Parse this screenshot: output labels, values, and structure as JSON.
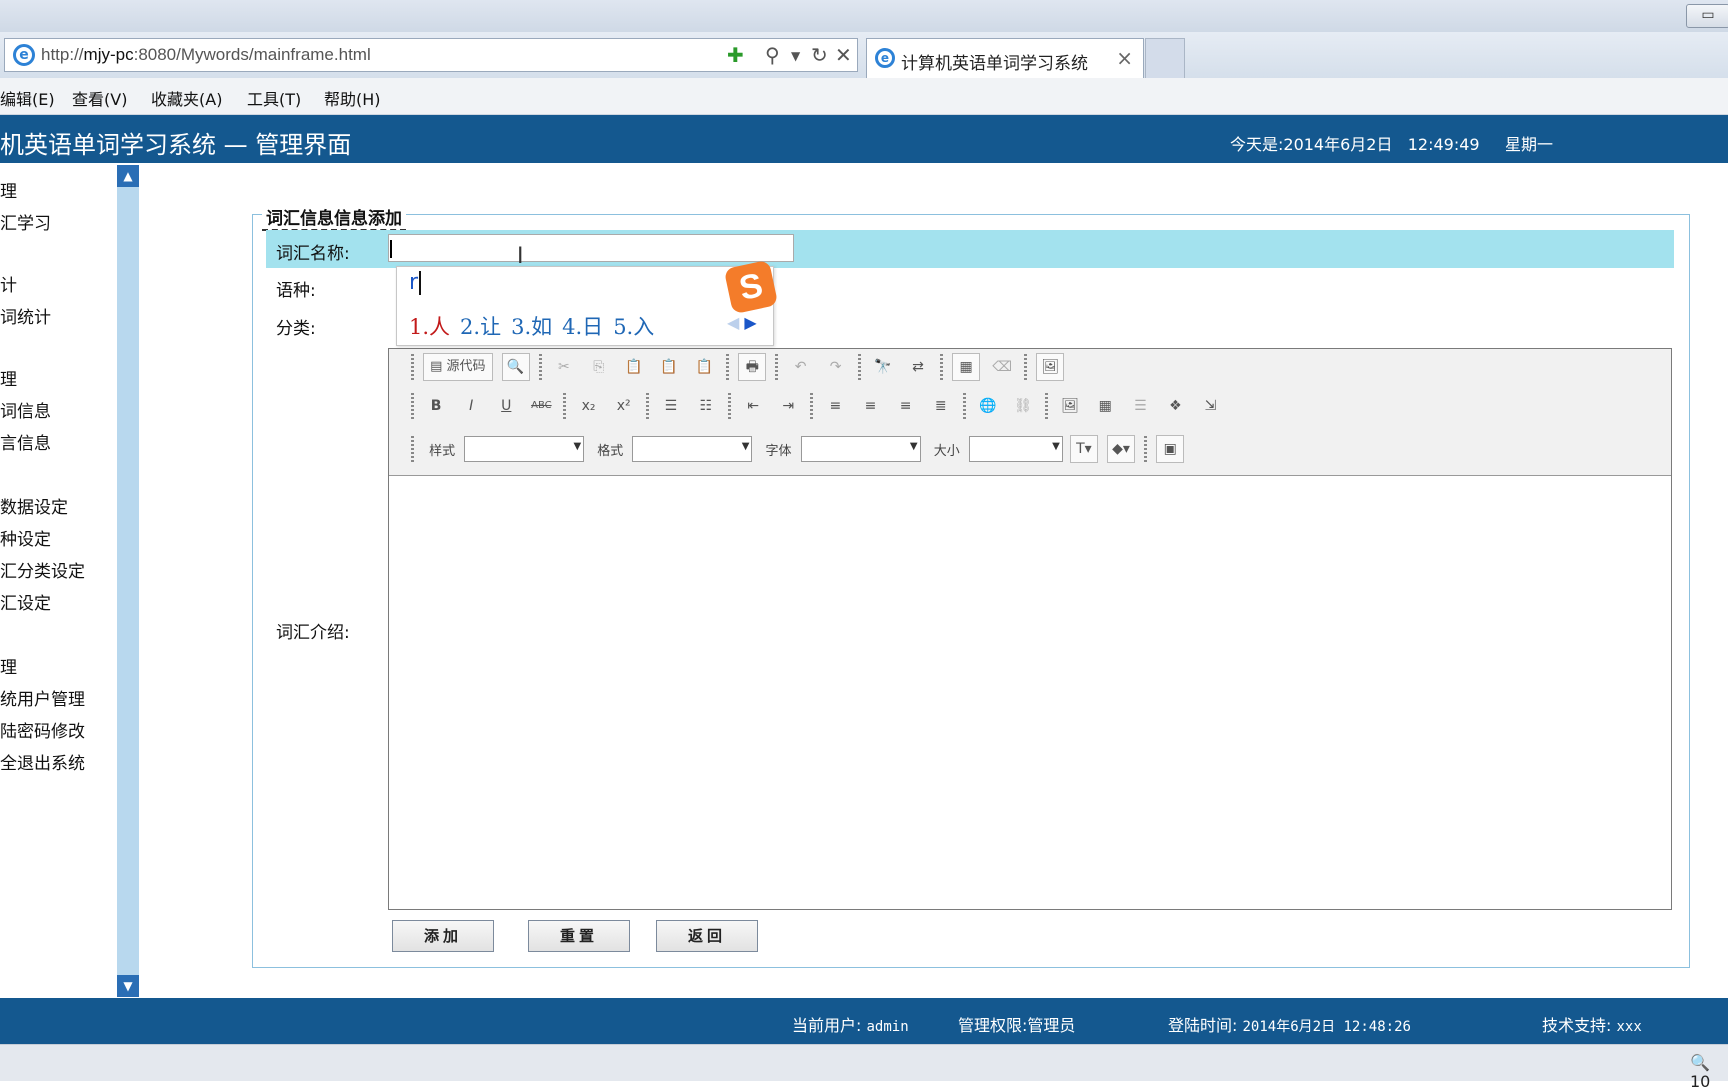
{
  "browser": {
    "url_prefix": "http://",
    "url_host": "mjy-pc",
    "url_rest": ":8080/Mywords/mainframe.html",
    "tab_title": "计算机英语单词学习系统",
    "tab_close": "×",
    "window_button": "▭",
    "menu": [
      "编辑(E)",
      "查看(V)",
      "收藏夹(A)",
      "工具(T)",
      "帮助(H)"
    ],
    "zoom": "10"
  },
  "header": {
    "title": "机英语单词学习系统 — 管理界面",
    "date_label": "今天是:2014年6月2日",
    "time": "12:49:49",
    "weekday": "星期一"
  },
  "sidebar": {
    "items": [
      "理",
      "汇学习",
      "计",
      "词统计",
      "理",
      "词信息",
      "言信息",
      "数据设定",
      "种设定",
      "汇分类设定",
      "汇设定",
      "理",
      "统用户管理",
      "陆密码修改",
      "全退出系统"
    ]
  },
  "form": {
    "legend": "词汇信息信息添加",
    "name_label": "词汇名称:",
    "name_value": "",
    "lang_label": "语种:",
    "category_label": "分类:",
    "intro_label": "词汇介绍:",
    "ime": {
      "composition": "r",
      "candidates": [
        "1.人",
        "2.让",
        "3.如",
        "4.日",
        "5.入"
      ],
      "logo": "S"
    },
    "editor": {
      "source_label": "源代码",
      "style_label": "样式",
      "format_label": "格式",
      "font_label": "字体",
      "size_label": "大小"
    },
    "buttons": {
      "add": "添加",
      "reset": "重置",
      "back": "返回"
    }
  },
  "footer": {
    "user_label": "当前用户:",
    "user": "admin",
    "role": "管理权限:管理员",
    "login_label": "登陆时间:",
    "login_time": "2014年6月2日 12:48:26",
    "support_label": "技术支持:",
    "support": "xxx"
  },
  "colors": {
    "header_bg": "#14588f",
    "row_highlight": "#a3e2ee",
    "fieldset_border": "#8cc0de"
  }
}
